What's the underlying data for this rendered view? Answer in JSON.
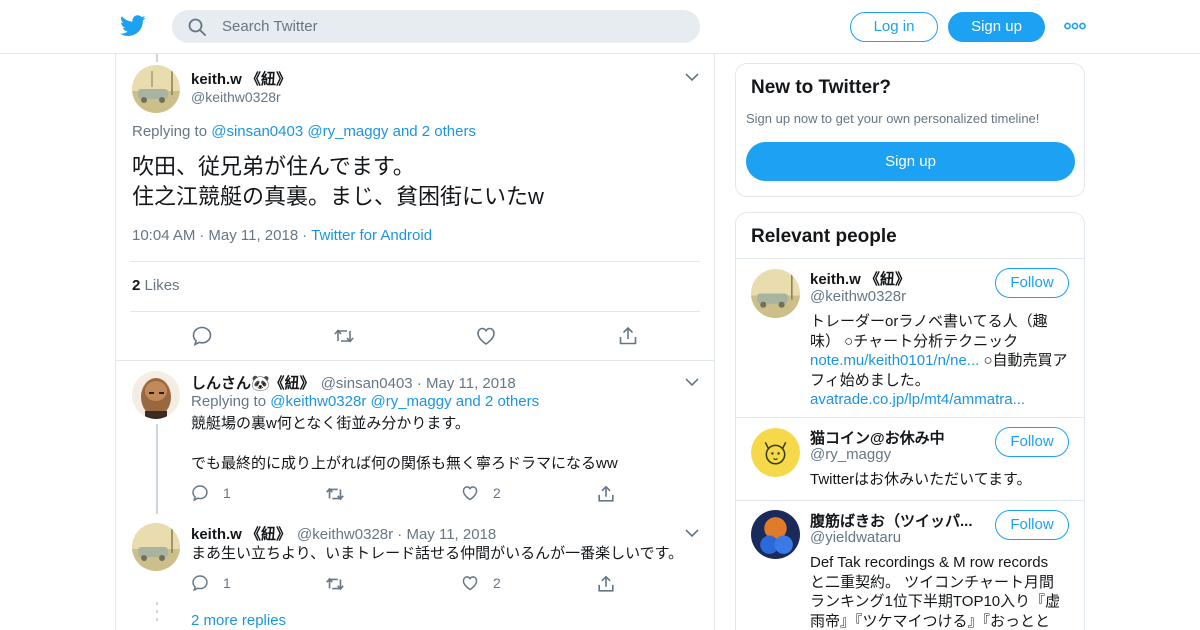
{
  "header": {
    "search_placeholder": "Search Twitter",
    "login_label": "Log in",
    "signup_label": "Sign up"
  },
  "focused_tweet": {
    "name": "keith.w 《紐》",
    "handle": "@keithw0328r",
    "replying_prefix": "Replying to",
    "replying_to": "@sinsan0403 @ry_maggy and 2 others",
    "text_line1": "吹田、従兄弟が住んでます。",
    "text_line2": "住之江競艇の真裏。まじ、貧困街にいたw",
    "time": "10:04 AM",
    "date": "May 11, 2018",
    "source": "Twitter for Android",
    "likes_count": "2",
    "likes_label": "Likes"
  },
  "replies": [
    {
      "name": "しんさん🐼《紐》",
      "handle": "@sinsan0403",
      "date": "· May 11, 2018",
      "replying_prefix": "Replying to",
      "replying_to": "@keithw0328r @ry_maggy and 2 others",
      "text_line1": "競艇場の裏w何となく街並み分かります。",
      "text_line2": "でも最終的に成り上がれば何の関係も無く寧ろドラマになるww",
      "reply_count": "1",
      "like_count": "2"
    },
    {
      "name": "keith.w 《紐》",
      "handle": "@keithw0328r",
      "date": "· May 11, 2018",
      "text_line1": "まあ生い立ちより、いまトレード話せる仲間がいるんが一番楽しいです。",
      "reply_count": "1",
      "like_count": "2"
    }
  ],
  "more_replies": "2 more replies",
  "sidebar": {
    "new_title": "New to Twitter?",
    "new_subtitle": "Sign up now to get your own personalized timeline!",
    "new_signup": "Sign up",
    "relevant_title": "Relevant people",
    "people": [
      {
        "name": "keith.w 《紐》",
        "handle": "@keithw0328r",
        "follow": "Follow",
        "bio_line1": "トレーダーorラノベ書いてる人（趣",
        "bio_line2": "味） ○チャート分析テクニック",
        "bio_link1": "note.mu/keith0101/n/ne...",
        "bio_line3_rest": " ○自動売買ア",
        "bio_line4": "フィ始めました。",
        "bio_link2": "avatrade.co.jp/lp/mt4/ammatra..."
      },
      {
        "name": "猫コイン@お休み中",
        "handle": "@ry_maggy",
        "follow": "Follow",
        "bio_line1": "Twitterはお休みいただいてます。"
      },
      {
        "name": "腹筋ばきお（ツイッパ...",
        "handle": "@yieldwataru",
        "follow": "Follow",
        "bio_line1": "Def Tak recordings & M row records",
        "bio_line2": "と二重契約。 ツイコンチャート月間",
        "bio_line3": "ランキング1位下半期TOP10入り『虚",
        "bio_line4": "雨帝』『ツケマイつける』『おっとと"
      }
    ]
  },
  "colors": {
    "accent": "#1da1f2",
    "link": "#1b95e0",
    "muted": "#657786",
    "border": "#e1e8ed"
  }
}
